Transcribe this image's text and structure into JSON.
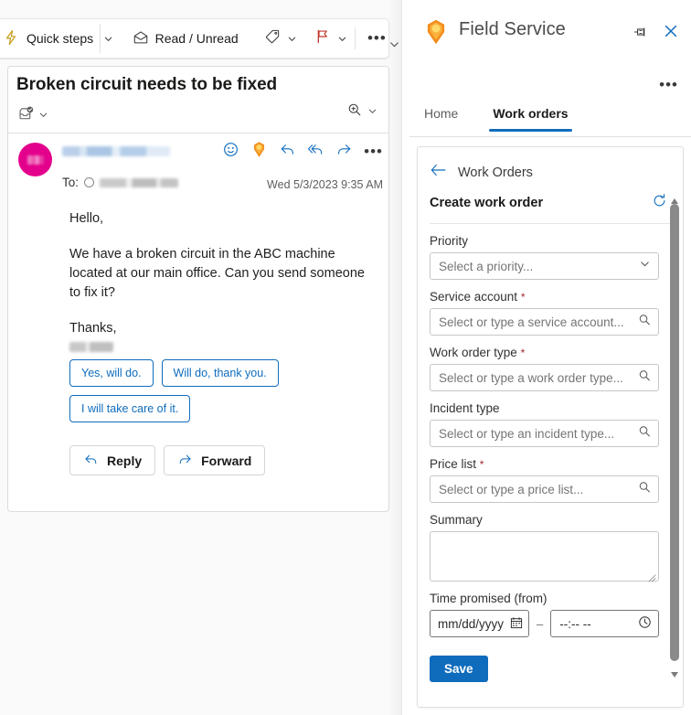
{
  "mail": {
    "toolbar": {
      "quick_steps_label": "Quick steps",
      "read_unread_label": "Read / Unread",
      "tag_icon": "tag-icon",
      "flag_icon": "flag-icon",
      "overflow_label": "•••"
    },
    "subject": "Broken circuit needs to be fixed",
    "date": "Wed 5/3/2023 9:35 AM",
    "to_label": "To:",
    "greeting": "Hello,",
    "body": "We have a broken circuit in the ABC machine located at   our main office. Can you send someone to fix it?",
    "signoff": "Thanks,",
    "suggestions": [
      "Yes, will do.",
      "Will do, thank you.",
      "I will take care of it."
    ],
    "reply_label": "Reply",
    "forward_label": "Forward",
    "avatar_color": "#e3008c"
  },
  "field_service": {
    "title": "Field Service",
    "pin_icon": "pin-icon",
    "close_icon": "close-icon",
    "overflow_label": "•••",
    "tabs": [
      {
        "label": "Home",
        "active": false
      },
      {
        "label": "Work orders",
        "active": true
      }
    ],
    "accent_color": "#0f6cbd",
    "panel": {
      "back_label": "Work Orders",
      "heading": "Create work order",
      "refresh_icon": "refresh-icon",
      "fields": [
        {
          "label": "Priority",
          "required": false,
          "placeholder": "Select a priority...",
          "icon": "chevron-down-icon"
        },
        {
          "label": "Service account",
          "required": true,
          "placeholder": "Select or type a service account...",
          "icon": "search-icon"
        },
        {
          "label": "Work order type",
          "required": true,
          "placeholder": "Select or type a work order type...",
          "icon": "search-icon"
        },
        {
          "label": "Incident type",
          "required": false,
          "placeholder": "Select or type an incident type...",
          "icon": "search-icon"
        },
        {
          "label": "Price list",
          "required": true,
          "placeholder": "Select or type a price list...",
          "icon": "search-icon"
        }
      ],
      "summary_label": "Summary",
      "summary_value": "",
      "time_promised_label": "Time promised (from)",
      "date_placeholder": "mm/dd/yyyy",
      "time_placeholder": "--:-- --",
      "range_separator": "–",
      "save_label": "Save",
      "required_marker": "*"
    }
  }
}
